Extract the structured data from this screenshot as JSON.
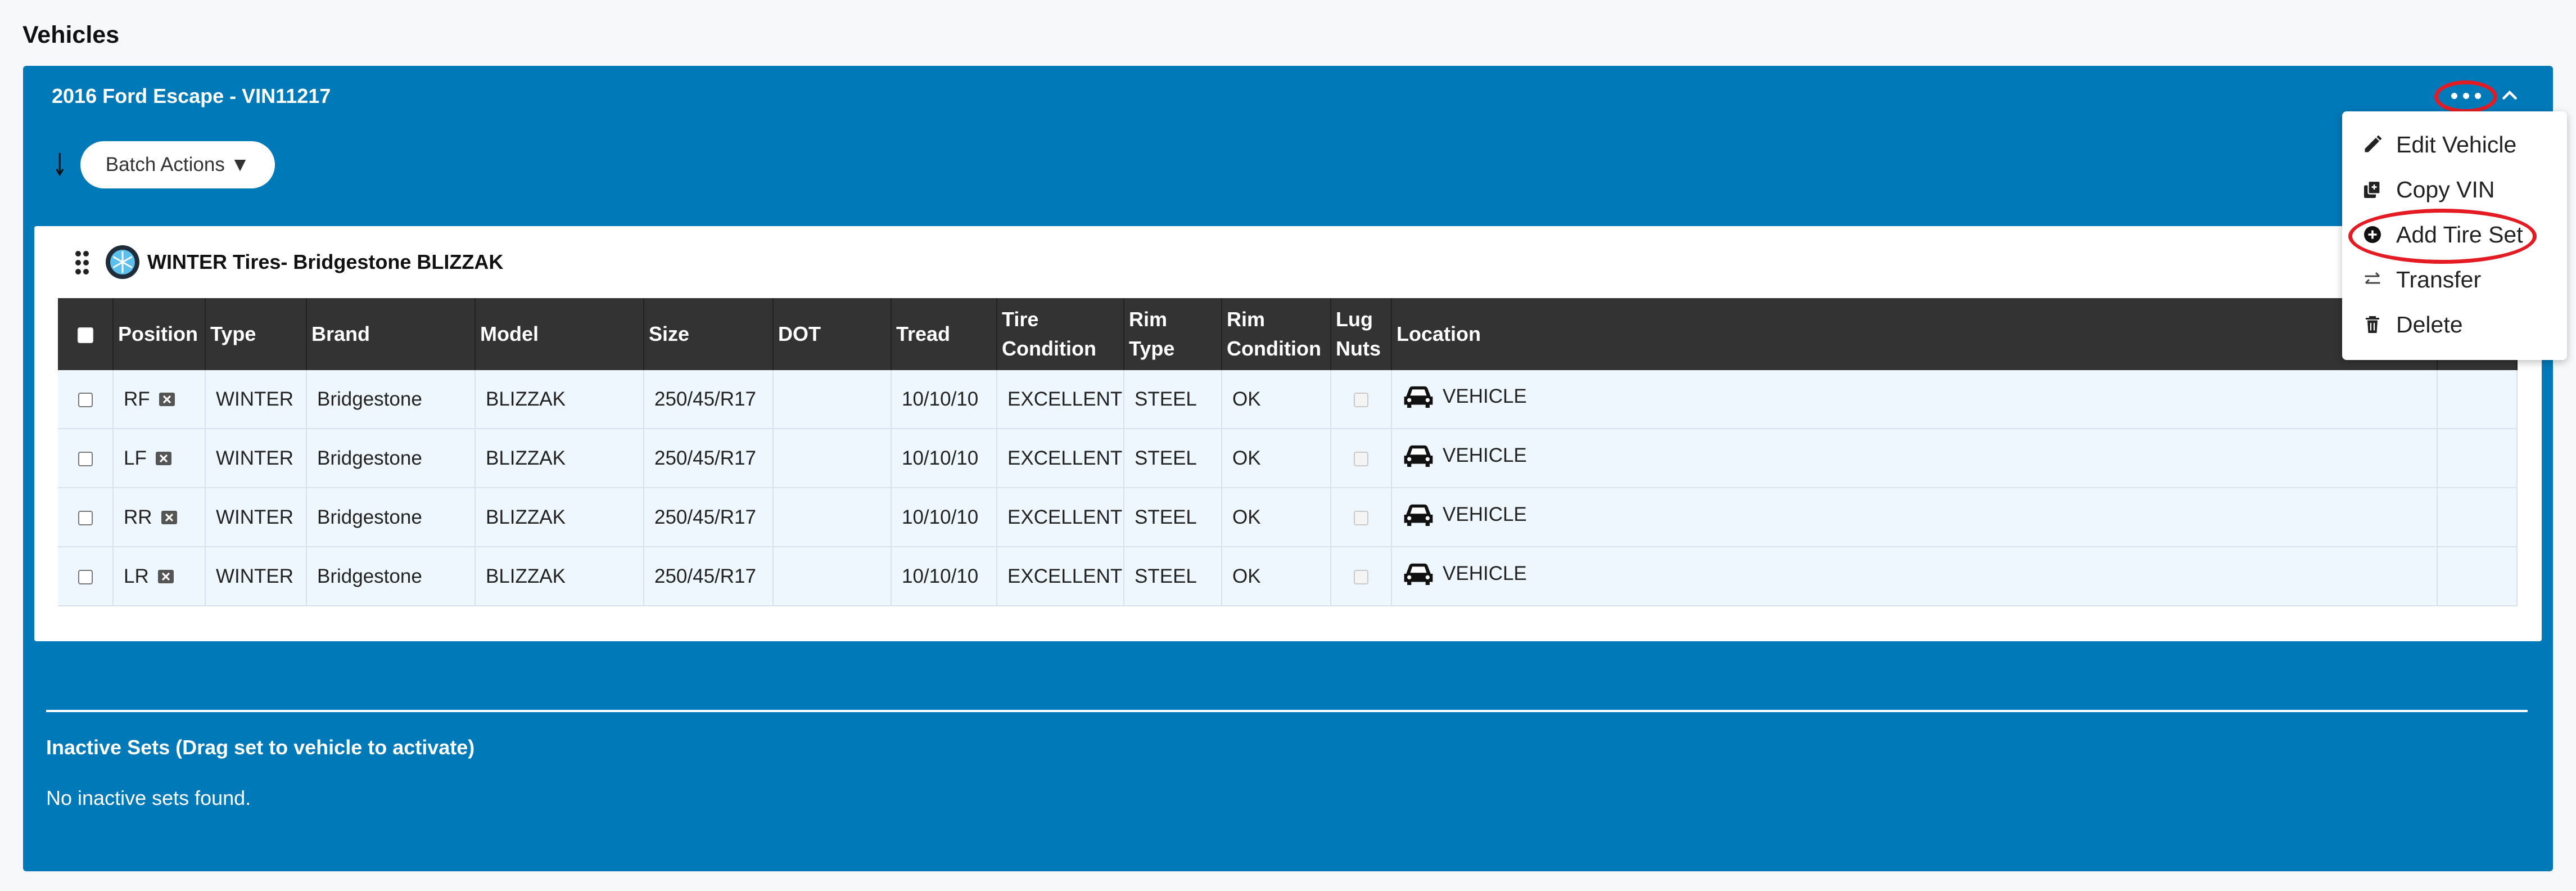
{
  "page": {
    "title": "Vehicles"
  },
  "vehicle": {
    "title": "2016 Ford Escape - VIN11217",
    "batch_label": "Batch Actions ▼"
  },
  "tire_set": {
    "title": "WINTER Tires- Bridgestone BLIZZAK",
    "columns": [
      {
        "key": "select",
        "label": ""
      },
      {
        "key": "position",
        "label": "Position"
      },
      {
        "key": "type",
        "label": "Type"
      },
      {
        "key": "brand",
        "label": "Brand"
      },
      {
        "key": "model",
        "label": "Model"
      },
      {
        "key": "size",
        "label": "Size"
      },
      {
        "key": "dot",
        "label": "DOT"
      },
      {
        "key": "tread",
        "label": "Tread"
      },
      {
        "key": "tire_condition",
        "label": "Tire Condition"
      },
      {
        "key": "rim_type",
        "label": "Rim Type"
      },
      {
        "key": "rim_condition",
        "label": "Rim Condition"
      },
      {
        "key": "lug_nuts",
        "label": "Lug Nuts"
      },
      {
        "key": "location",
        "label": "Location"
      }
    ],
    "rows": [
      {
        "position": "RF",
        "type": "WINTER",
        "brand": "Bridgestone",
        "model": "BLIZZAK",
        "size": "250/45/R17",
        "dot": "",
        "tread": "10/10/10",
        "tire_condition": "EXCELLENT",
        "rim_type": "STEEL",
        "rim_condition": "OK",
        "location": "VEHICLE"
      },
      {
        "position": "LF",
        "type": "WINTER",
        "brand": "Bridgestone",
        "model": "BLIZZAK",
        "size": "250/45/R17",
        "dot": "",
        "tread": "10/10/10",
        "tire_condition": "EXCELLENT",
        "rim_type": "STEEL",
        "rim_condition": "OK",
        "location": "VEHICLE"
      },
      {
        "position": "RR",
        "type": "WINTER",
        "brand": "Bridgestone",
        "model": "BLIZZAK",
        "size": "250/45/R17",
        "dot": "",
        "tread": "10/10/10",
        "tire_condition": "EXCELLENT",
        "rim_type": "STEEL",
        "rim_condition": "OK",
        "location": "VEHICLE"
      },
      {
        "position": "LR",
        "type": "WINTER",
        "brand": "Bridgestone",
        "model": "BLIZZAK",
        "size": "250/45/R17",
        "dot": "",
        "tread": "10/10/10",
        "tire_condition": "EXCELLENT",
        "rim_type": "STEEL",
        "rim_condition": "OK",
        "location": "VEHICLE"
      }
    ]
  },
  "inactive": {
    "title": "Inactive Sets (Drag set to vehicle to activate)",
    "empty_text": "No inactive sets found."
  },
  "menu": {
    "items": [
      {
        "label": "Edit Vehicle",
        "icon": "pencil-icon"
      },
      {
        "label": "Copy VIN",
        "icon": "copy-icon"
      },
      {
        "label": "Add Tire Set",
        "icon": "plus-circle-icon"
      },
      {
        "label": "Transfer",
        "icon": "transfer-icon"
      },
      {
        "label": "Delete",
        "icon": "trash-icon"
      }
    ]
  },
  "colors": {
    "panel": "#0079b8",
    "table_header": "#333333",
    "row_bg": "#eef7fe",
    "annotation": "#e41b23"
  }
}
